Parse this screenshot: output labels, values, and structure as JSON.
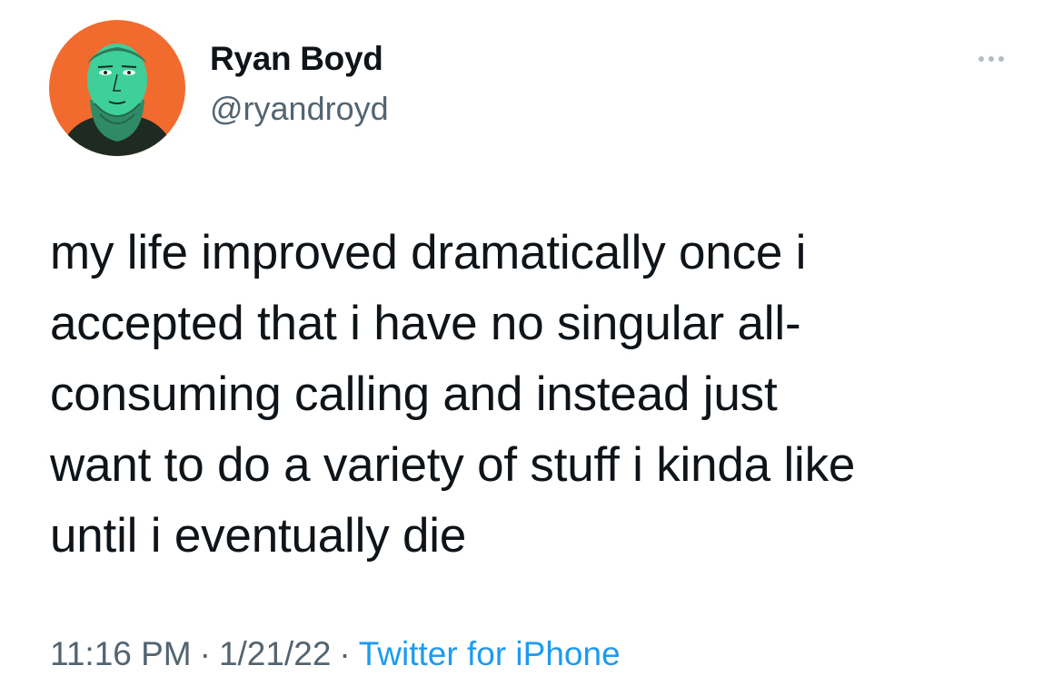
{
  "author": {
    "display_name": "Ryan Boyd",
    "handle": "@ryandroyd",
    "avatar_icon": "bearded-man-portrait-avatar"
  },
  "more_icon": "ellipsis-icon",
  "tweet": {
    "lines": [
      "my life improved dramatically once i",
      "accepted that i have no singular all-",
      "consuming calling and instead just",
      "want to do a variety of stuff i kinda like",
      "until i eventually die"
    ]
  },
  "meta": {
    "time": "11:16 PM",
    "separator": "·",
    "date": "1/21/22",
    "source": "Twitter for iPhone"
  },
  "colors": {
    "text": "#0f1419",
    "secondary": "#536471",
    "link": "#1d9bf0",
    "avatar_bg": "#f26b2e",
    "avatar_face": "#3fcf9a"
  }
}
